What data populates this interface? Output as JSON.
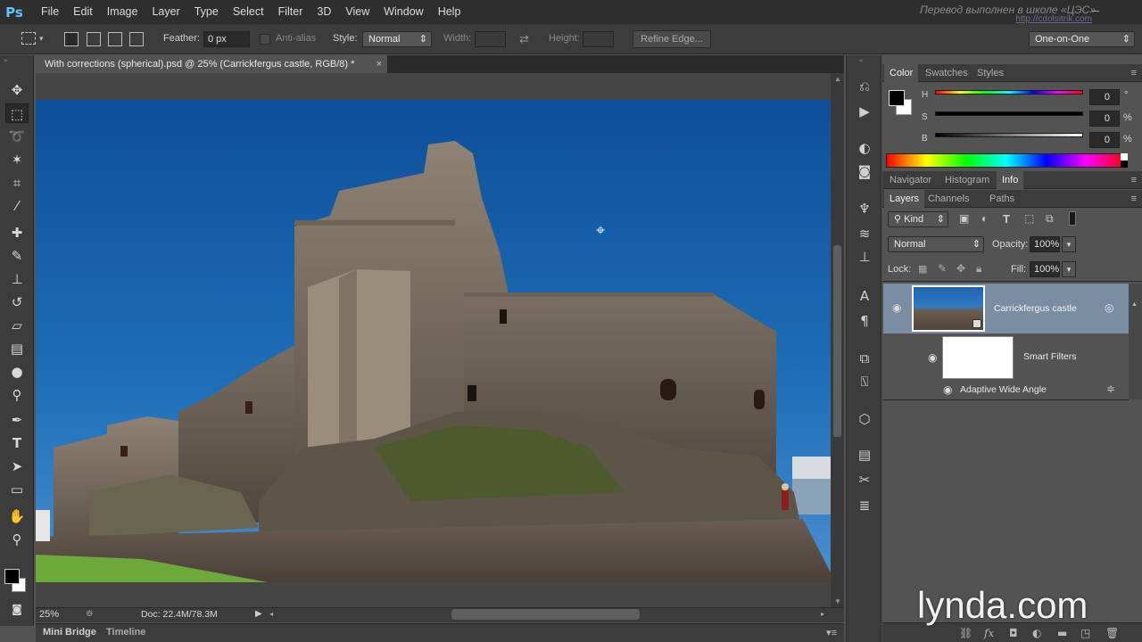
{
  "app": {
    "logo": "Ps"
  },
  "menu": [
    "File",
    "Edit",
    "Image",
    "Layer",
    "Type",
    "Select",
    "Filter",
    "3D",
    "View",
    "Window",
    "Help"
  ],
  "watermark": {
    "text": "Перевод выполнен в школе «ЦЭС»",
    "url": "http://cdolsitrik.com"
  },
  "options": {
    "feather_label": "Feather:",
    "feather_value": "0 px",
    "antialias_label": "Anti-alias",
    "style_label": "Style:",
    "style_value": "Normal",
    "width_label": "Width:",
    "height_label": "Height:",
    "refine_edge": "Refine Edge...",
    "workspace": "One-on-One"
  },
  "document": {
    "tab_title": "With corrections (spherical).psd @ 25% (Carrickfergus castle, RGB/8) *",
    "close": "×",
    "zoom": "25%",
    "doc_size": "Doc: 22.4M/78.3M"
  },
  "bottom_tabs": [
    "Mini Bridge",
    "Timeline"
  ],
  "color_panel": {
    "tabs": [
      "Color",
      "Swatches",
      "Styles"
    ],
    "sliders": [
      {
        "label": "H",
        "value": "0",
        "unit": "°"
      },
      {
        "label": "S",
        "value": "0",
        "unit": "%"
      },
      {
        "label": "B",
        "value": "0",
        "unit": "%"
      }
    ]
  },
  "info_panel": {
    "tabs": [
      "Navigator",
      "Histogram",
      "Info"
    ]
  },
  "layers_panel": {
    "tabs": [
      "Layers",
      "Channels",
      "Paths"
    ],
    "kind": "Kind",
    "blend_mode": "Normal",
    "opacity_label": "Opacity:",
    "opacity_value": "100%",
    "lock_label": "Lock:",
    "fill_label": "Fill:",
    "fill_value": "100%",
    "layers": [
      {
        "name": "Carrickfergus castle"
      },
      {
        "name": "Smart Filters"
      },
      {
        "name": "Adaptive Wide Angle"
      }
    ]
  },
  "brand": "lynda.com",
  "colors": {
    "sky": "#1f6fb5",
    "panel": "#535353",
    "dark": "#3c3c3c",
    "accent": "#5ec5f8"
  }
}
